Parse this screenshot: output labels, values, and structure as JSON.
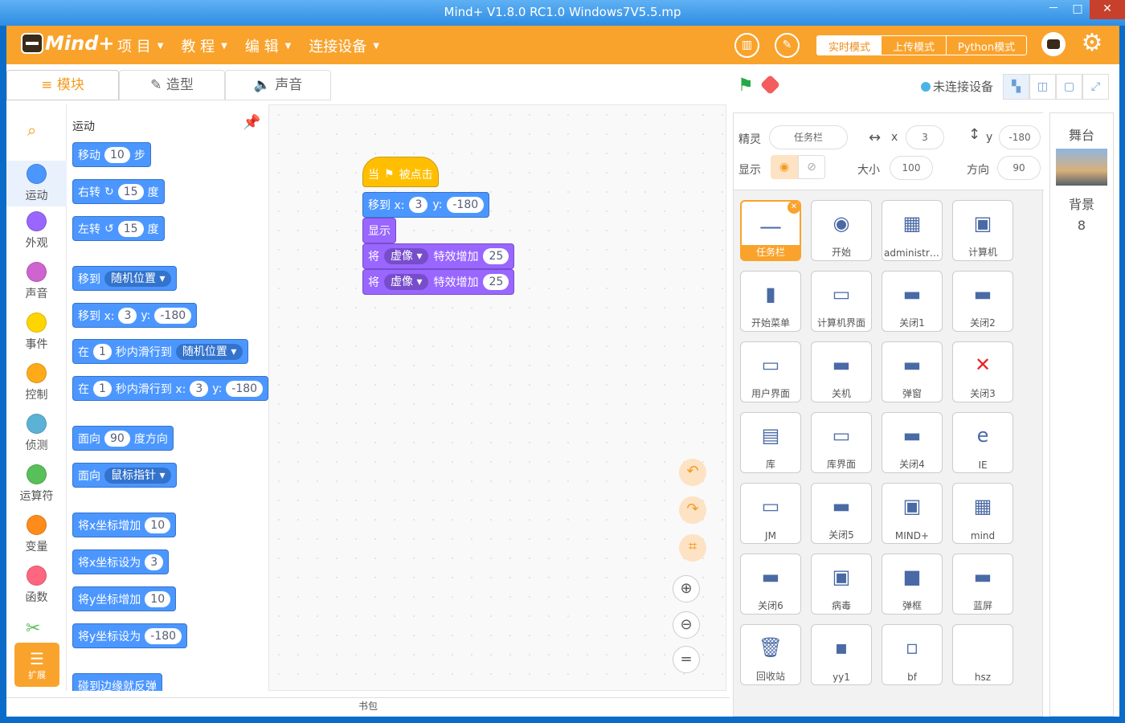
{
  "window": {
    "title": "Mind+ V1.8.0 RC1.0   Windows7V5.5.mp",
    "minimize": "－",
    "maximize": "□",
    "close": "✕"
  },
  "menubar": {
    "logo": "Mind+",
    "menus": [
      "项 目",
      "教 程",
      "编 辑",
      "连接设备"
    ],
    "mode_buttons": [
      "实时模式",
      "上传模式",
      "Python模式"
    ],
    "active_mode": "实时模式"
  },
  "tabs": [
    {
      "label": "模块",
      "icon": "≡"
    },
    {
      "label": "造型",
      "icon": "✎"
    },
    {
      "label": "声音",
      "icon": "🔈"
    }
  ],
  "stage_controls": {
    "connection": "未连接设备"
  },
  "categories": [
    {
      "label": "运动",
      "color": "#4c97ff"
    },
    {
      "label": "外观",
      "color": "#9966ff"
    },
    {
      "label": "声音",
      "color": "#cf63cf"
    },
    {
      "label": "事件",
      "color": "#ffd500"
    },
    {
      "label": "控制",
      "color": "#ffab19"
    },
    {
      "label": "侦测",
      "color": "#5cb1d6"
    },
    {
      "label": "运算符",
      "color": "#59c059"
    },
    {
      "label": "变量",
      "color": "#ff8c1a"
    },
    {
      "label": "函数",
      "color": "#ff6680"
    }
  ],
  "extension_label": "扩展",
  "palette": {
    "heading": "运动",
    "blocks": [
      {
        "parts": [
          "移动",
          {
            "v": "10"
          },
          "步"
        ]
      },
      {
        "parts": [
          "右转",
          "↻",
          {
            "v": "15"
          },
          "度"
        ]
      },
      {
        "parts": [
          "左转",
          "↺",
          {
            "v": "15"
          },
          "度"
        ]
      },
      {
        "parts": [
          "移到",
          {
            "d": "随机位置"
          }
        ]
      },
      {
        "parts": [
          "移到 x:",
          {
            "v": "3"
          },
          "y:",
          {
            "v": "-180"
          }
        ]
      },
      {
        "parts": [
          "在",
          {
            "v": "1"
          },
          "秒内滑行到",
          {
            "d": "随机位置"
          }
        ]
      },
      {
        "parts": [
          "在",
          {
            "v": "1"
          },
          "秒内滑行到 x:",
          {
            "v": "3"
          },
          "y:",
          {
            "v": "-180"
          }
        ]
      },
      {
        "parts": [
          "面向",
          {
            "v": "90"
          },
          "度方向"
        ]
      },
      {
        "parts": [
          "面向",
          {
            "d": "鼠标指针"
          }
        ]
      },
      {
        "parts": [
          "将x坐标增加",
          {
            "v": "10"
          }
        ]
      },
      {
        "parts": [
          "将x坐标设为",
          {
            "v": "3"
          }
        ]
      },
      {
        "parts": [
          "将y坐标增加",
          {
            "v": "10"
          }
        ]
      },
      {
        "parts": [
          "将y坐标设为",
          {
            "v": "-180"
          }
        ]
      },
      {
        "parts": [
          "碰到边缘就反弹"
        ]
      }
    ]
  },
  "script": [
    {
      "type": "hat",
      "parts": [
        "当",
        "⚑",
        "被点击"
      ]
    },
    {
      "type": "motion",
      "parts": [
        "移到 x:",
        {
          "v": "3"
        },
        "y:",
        {
          "v": "-180"
        }
      ]
    },
    {
      "type": "looks",
      "parts": [
        "显示"
      ]
    },
    {
      "type": "looks",
      "parts": [
        "将",
        {
          "d": "虚像"
        },
        "特效增加",
        {
          "v": "25"
        }
      ]
    },
    {
      "type": "looks",
      "parts": [
        "将",
        {
          "d": "虚像"
        },
        "特效增加",
        {
          "v": "25"
        }
      ]
    }
  ],
  "backpack": "书包",
  "sprite_info": {
    "sprite_label": "精灵",
    "sprite_name": "任务栏",
    "x_label": "x",
    "x": "3",
    "y_label": "y",
    "y": "-180",
    "show_label": "显示",
    "size_label": "大小",
    "size": "100",
    "direction_label": "方向",
    "direction": "90"
  },
  "sprites": [
    "任务栏",
    "开始",
    "administra...",
    "计算机",
    "开始菜单",
    "计算机界面",
    "关闭1",
    "关闭2",
    "用户界面",
    "关机",
    "弹窗",
    "关闭3",
    "库",
    "库界面",
    "关闭4",
    "IE",
    "JM",
    "关闭5",
    "MIND+",
    "mind",
    "关闭6",
    "病毒",
    "弹框",
    "蓝屏",
    "回收站",
    "yy1",
    "bf",
    "hsz"
  ],
  "selected_sprite": "任务栏",
  "stage": {
    "label": "舞台",
    "backdrop_label": "背景",
    "backdrop_count": "8"
  }
}
